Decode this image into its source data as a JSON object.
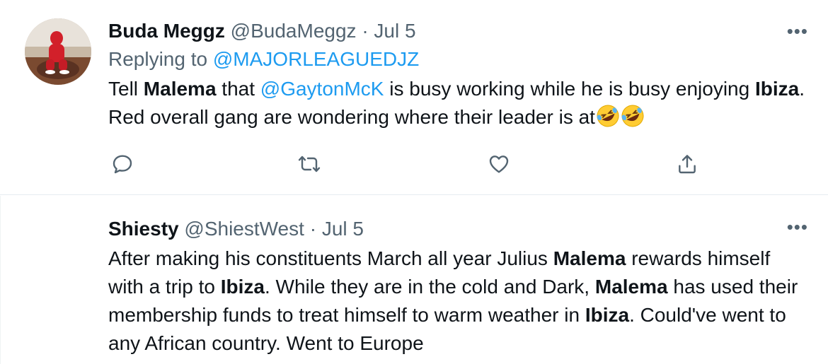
{
  "tweets": [
    {
      "display_name": "Buda Meggz",
      "handle": "@BudaMeggz",
      "separator": "·",
      "date": "Jul 5",
      "replying_prefix": "Replying to",
      "replying_to": "@MAJORLEAGUEDJZ",
      "text": {
        "p1": "Tell ",
        "b1": "Malema",
        "p2": " that ",
        "mention": "@GaytonMcK",
        "p3": "  is busy working while he is busy enjoying ",
        "b2": "Ibiza",
        "p4": ". Red overall gang are wondering where their leader is at"
      },
      "emoji": [
        "rolling-on-floor-laughing",
        "rolling-on-floor-laughing"
      ],
      "more_label": "•••",
      "actions": [
        "reply-icon",
        "retweet-icon",
        "like-icon",
        "share-icon"
      ]
    },
    {
      "display_name": "Shiesty",
      "handle": "@ShiestWest",
      "separator": "·",
      "date": "Jul 5",
      "text": {
        "p1": "After making his constituents March all year Julius ",
        "b1": "Malema",
        "p2": " rewards himself with a trip to ",
        "b2": "Ibiza",
        "p3": ". While they are in the cold and Dark, ",
        "b3": "Malema",
        "p4": " has used their membership funds to treat himself to warm weather in ",
        "b4": "Ibiza",
        "p5": ". Could've went to any African country. Went to Europe"
      },
      "more_label": "•••"
    }
  ],
  "colors": {
    "text": "#0f1419",
    "secondary": "#536471",
    "link": "#1d9bf0",
    "divider": "#e6ecf0"
  }
}
